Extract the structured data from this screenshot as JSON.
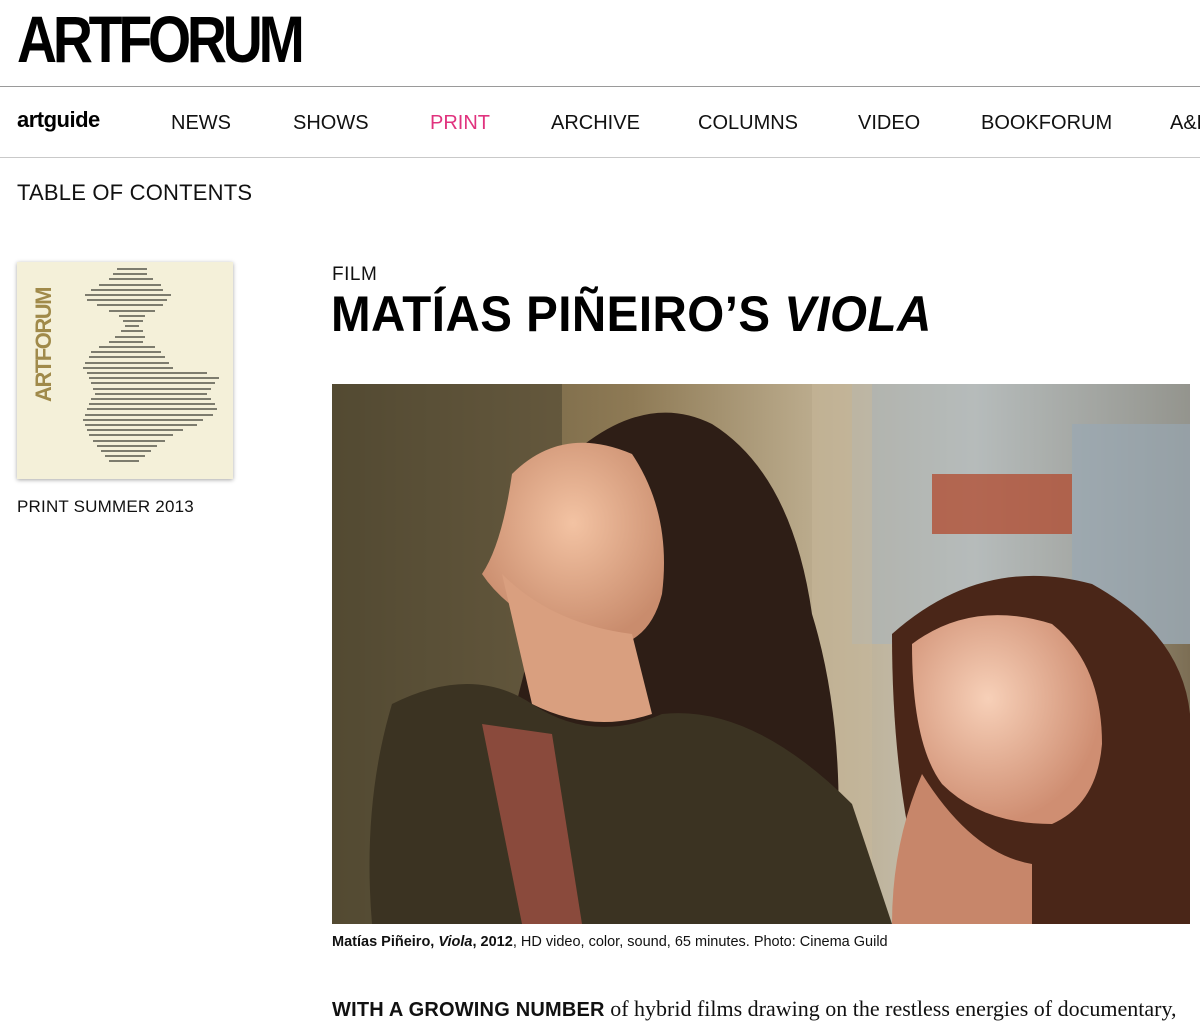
{
  "header": {
    "logo": "ARTFORUM"
  },
  "nav": {
    "artguide": "artguide",
    "items": [
      {
        "label": "NEWS"
      },
      {
        "label": "SHOWS"
      },
      {
        "label": "PRINT"
      },
      {
        "label": "ARCHIVE"
      },
      {
        "label": "COLUMNS"
      },
      {
        "label": "VIDEO"
      },
      {
        "label": "BOOKFORUM"
      },
      {
        "label": "A&E"
      }
    ],
    "active": "PRINT"
  },
  "toc": "TABLE OF CONTENTS",
  "issue": {
    "cover_logo": "ARTFORUM",
    "label": "PRINT SUMMER 2013"
  },
  "article": {
    "kicker": "FILM",
    "title_main": "MATÍAS PIÑEIRO’S ",
    "title_italic": "VIOLA",
    "caption": {
      "name": "Matías Piñeiro, ",
      "work": "Viola",
      "year": ", 2012",
      "details": ", HD video, color, sound, 65 minutes. Photo: Cinema Guild"
    },
    "lede_caps": "WITH A GROWING NUMBER",
    "lede_text": " of hybrid films drawing on the restless energies of documentary,"
  },
  "colors": {
    "accent": "#e0337e",
    "text": "#111111"
  }
}
